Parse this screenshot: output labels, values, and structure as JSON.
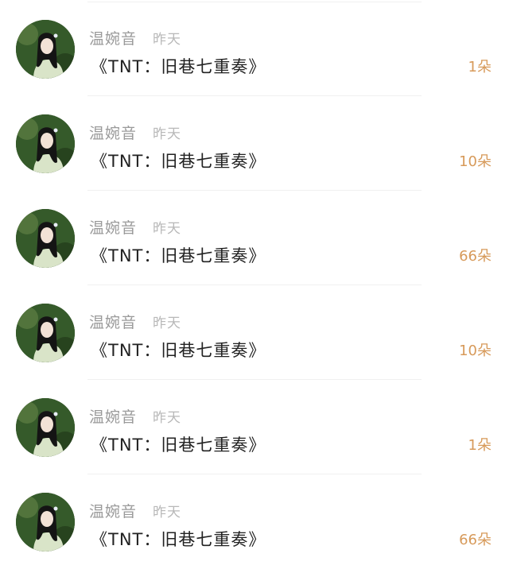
{
  "rows": [
    {
      "name": "温婉音",
      "time": "昨天",
      "gift": "《TNT：旧巷七重奏》",
      "count": "1朵"
    },
    {
      "name": "温婉音",
      "time": "昨天",
      "gift": "《TNT：旧巷七重奏》",
      "count": "10朵"
    },
    {
      "name": "温婉音",
      "time": "昨天",
      "gift": "《TNT：旧巷七重奏》",
      "count": "66朵"
    },
    {
      "name": "温婉音",
      "time": "昨天",
      "gift": "《TNT：旧巷七重奏》",
      "count": "10朵"
    },
    {
      "name": "温婉音",
      "time": "昨天",
      "gift": "《TNT：旧巷七重奏》",
      "count": "1朵"
    },
    {
      "name": "温婉音",
      "time": "昨天",
      "gift": "《TNT：旧巷七重奏》",
      "count": "66朵"
    }
  ],
  "colors": {
    "name": "#9a9a9a",
    "time": "#b8b8b8",
    "gift": "#222222",
    "count": "#d79a5a",
    "avatar_background": "#2d4a24"
  }
}
